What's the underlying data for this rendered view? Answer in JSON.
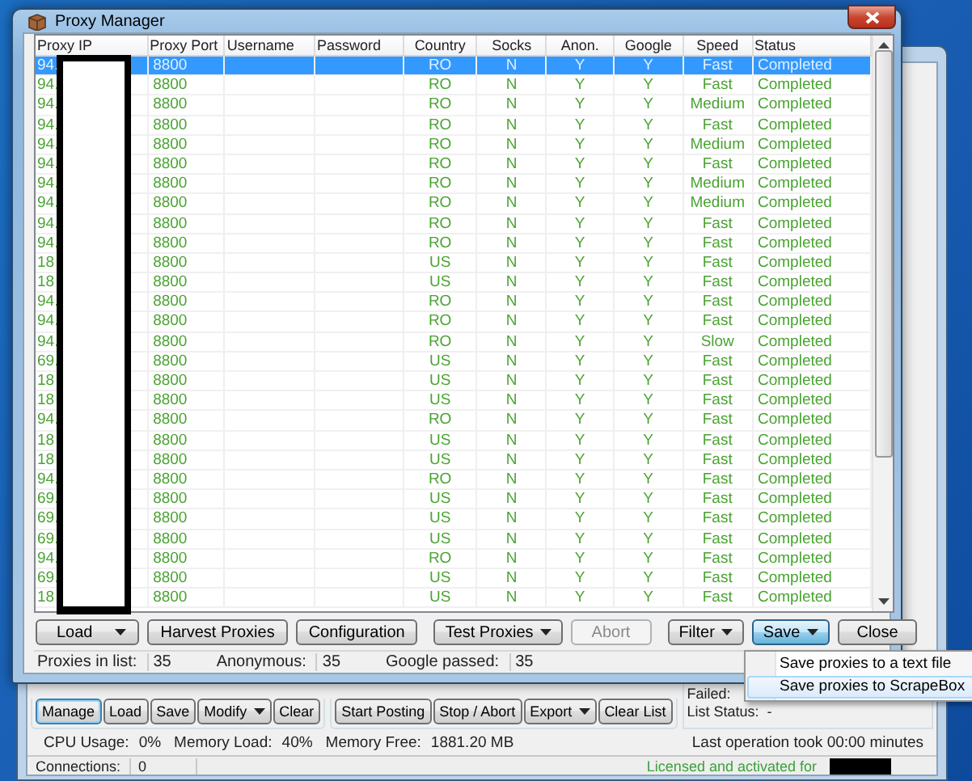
{
  "main_window": {
    "manage_buttons": [
      {
        "label": "Manage",
        "dropdown": false,
        "focused": true
      },
      {
        "label": "Load",
        "dropdown": false,
        "focused": false
      },
      {
        "label": "Save",
        "dropdown": false,
        "focused": false
      },
      {
        "label": "Modify",
        "dropdown": true,
        "focused": false
      },
      {
        "label": "Clear",
        "dropdown": false,
        "focused": false
      }
    ],
    "posting_buttons": [
      {
        "label": "Start Posting",
        "dropdown": false,
        "focused": false
      },
      {
        "label": "Stop / Abort",
        "dropdown": false,
        "focused": false
      },
      {
        "label": "Export",
        "dropdown": true,
        "focused": false
      },
      {
        "label": "Clear List",
        "dropdown": false,
        "focused": false
      }
    ],
    "failed_label": "Failed:",
    "list_status": "List Status:  -",
    "system": [
      {
        "label": "CPU Usage:",
        "value": "0%"
      },
      {
        "label": "Memory Load:",
        "value": "40%"
      },
      {
        "label": "Memory Free:",
        "value": "1881.20 MB"
      }
    ],
    "last_operation": "Last operation took 00:00 minutes",
    "status_bar": {
      "connections_label": "Connections:",
      "connections": "0",
      "license": "Licensed and activated for"
    }
  },
  "proxy_manager": {
    "title": "Proxy Manager",
    "table": {
      "columns": [
        "Proxy IP",
        "Proxy Port",
        "Username",
        "Password",
        "Country",
        "Socks",
        "Anon.",
        "Google",
        "Speed",
        "Status"
      ],
      "rows": [
        {
          "proxy_ip": "94.",
          "proxy_port": "8800",
          "country": "RO",
          "socks": "N",
          "anon": "Y",
          "google": "Y",
          "speed": "Fast",
          "status": "Completed",
          "selected": true
        },
        {
          "proxy_ip": "94.",
          "proxy_port": "8800",
          "country": "RO",
          "socks": "N",
          "anon": "Y",
          "google": "Y",
          "speed": "Fast",
          "status": "Completed",
          "selected": false
        },
        {
          "proxy_ip": "94.",
          "proxy_port": "8800",
          "country": "RO",
          "socks": "N",
          "anon": "Y",
          "google": "Y",
          "speed": "Medium",
          "status": "Completed",
          "selected": false
        },
        {
          "proxy_ip": "94.",
          "proxy_port": "8800",
          "country": "RO",
          "socks": "N",
          "anon": "Y",
          "google": "Y",
          "speed": "Fast",
          "status": "Completed",
          "selected": false
        },
        {
          "proxy_ip": "94.",
          "proxy_port": "8800",
          "country": "RO",
          "socks": "N",
          "anon": "Y",
          "google": "Y",
          "speed": "Medium",
          "status": "Completed",
          "selected": false
        },
        {
          "proxy_ip": "94.",
          "proxy_port": "8800",
          "country": "RO",
          "socks": "N",
          "anon": "Y",
          "google": "Y",
          "speed": "Fast",
          "status": "Completed",
          "selected": false
        },
        {
          "proxy_ip": "94.",
          "proxy_port": "8800",
          "country": "RO",
          "socks": "N",
          "anon": "Y",
          "google": "Y",
          "speed": "Medium",
          "status": "Completed",
          "selected": false
        },
        {
          "proxy_ip": "94.",
          "proxy_port": "8800",
          "country": "RO",
          "socks": "N",
          "anon": "Y",
          "google": "Y",
          "speed": "Medium",
          "status": "Completed",
          "selected": false
        },
        {
          "proxy_ip": "94.",
          "proxy_port": "8800",
          "country": "RO",
          "socks": "N",
          "anon": "Y",
          "google": "Y",
          "speed": "Fast",
          "status": "Completed",
          "selected": false
        },
        {
          "proxy_ip": "94.",
          "proxy_port": "8800",
          "country": "RO",
          "socks": "N",
          "anon": "Y",
          "google": "Y",
          "speed": "Fast",
          "status": "Completed",
          "selected": false
        },
        {
          "proxy_ip": "18",
          "proxy_port": "8800",
          "country": "US",
          "socks": "N",
          "anon": "Y",
          "google": "Y",
          "speed": "Fast",
          "status": "Completed",
          "selected": false
        },
        {
          "proxy_ip": "18",
          "proxy_port": "8800",
          "country": "US",
          "socks": "N",
          "anon": "Y",
          "google": "Y",
          "speed": "Fast",
          "status": "Completed",
          "selected": false
        },
        {
          "proxy_ip": "94.",
          "proxy_port": "8800",
          "country": "RO",
          "socks": "N",
          "anon": "Y",
          "google": "Y",
          "speed": "Fast",
          "status": "Completed",
          "selected": false
        },
        {
          "proxy_ip": "94.",
          "proxy_port": "8800",
          "country": "RO",
          "socks": "N",
          "anon": "Y",
          "google": "Y",
          "speed": "Fast",
          "status": "Completed",
          "selected": false
        },
        {
          "proxy_ip": "94.",
          "proxy_port": "8800",
          "country": "RO",
          "socks": "N",
          "anon": "Y",
          "google": "Y",
          "speed": "Slow",
          "status": "Completed",
          "selected": false
        },
        {
          "proxy_ip": "69.",
          "proxy_port": "8800",
          "country": "US",
          "socks": "N",
          "anon": "Y",
          "google": "Y",
          "speed": "Fast",
          "status": "Completed",
          "selected": false
        },
        {
          "proxy_ip": "18",
          "proxy_port": "8800",
          "country": "US",
          "socks": "N",
          "anon": "Y",
          "google": "Y",
          "speed": "Fast",
          "status": "Completed",
          "selected": false
        },
        {
          "proxy_ip": "18",
          "proxy_port": "8800",
          "country": "US",
          "socks": "N",
          "anon": "Y",
          "google": "Y",
          "speed": "Fast",
          "status": "Completed",
          "selected": false
        },
        {
          "proxy_ip": "94.",
          "proxy_port": "8800",
          "country": "RO",
          "socks": "N",
          "anon": "Y",
          "google": "Y",
          "speed": "Fast",
          "status": "Completed",
          "selected": false
        },
        {
          "proxy_ip": "18",
          "proxy_port": "8800",
          "country": "US",
          "socks": "N",
          "anon": "Y",
          "google": "Y",
          "speed": "Fast",
          "status": "Completed",
          "selected": false
        },
        {
          "proxy_ip": "18",
          "proxy_port": "8800",
          "country": "US",
          "socks": "N",
          "anon": "Y",
          "google": "Y",
          "speed": "Fast",
          "status": "Completed",
          "selected": false
        },
        {
          "proxy_ip": "94.",
          "proxy_port": "8800",
          "country": "RO",
          "socks": "N",
          "anon": "Y",
          "google": "Y",
          "speed": "Fast",
          "status": "Completed",
          "selected": false
        },
        {
          "proxy_ip": "69.",
          "proxy_port": "8800",
          "country": "US",
          "socks": "N",
          "anon": "Y",
          "google": "Y",
          "speed": "Fast",
          "status": "Completed",
          "selected": false
        },
        {
          "proxy_ip": "69.",
          "proxy_port": "8800",
          "country": "US",
          "socks": "N",
          "anon": "Y",
          "google": "Y",
          "speed": "Fast",
          "status": "Completed",
          "selected": false
        },
        {
          "proxy_ip": "69.",
          "proxy_port": "8800",
          "country": "US",
          "socks": "N",
          "anon": "Y",
          "google": "Y",
          "speed": "Fast",
          "status": "Completed",
          "selected": false
        },
        {
          "proxy_ip": "94.",
          "proxy_port": "8800",
          "country": "RO",
          "socks": "N",
          "anon": "Y",
          "google": "Y",
          "speed": "Fast",
          "status": "Completed",
          "selected": false
        },
        {
          "proxy_ip": "69.",
          "proxy_port": "8800",
          "country": "US",
          "socks": "N",
          "anon": "Y",
          "google": "Y",
          "speed": "Fast",
          "status": "Completed",
          "selected": false
        },
        {
          "proxy_ip": "18",
          "proxy_port": "8800",
          "country": "US",
          "socks": "N",
          "anon": "Y",
          "google": "Y",
          "speed": "Fast",
          "status": "Completed",
          "selected": false
        }
      ]
    },
    "file_buttons": [
      {
        "label": "Load",
        "dropdown": true,
        "disabled": false,
        "pressed": false
      },
      {
        "label": "Harvest Proxies",
        "dropdown": false,
        "disabled": false,
        "pressed": false
      },
      {
        "label": "Configuration",
        "dropdown": false,
        "disabled": false,
        "pressed": false
      }
    ],
    "test_buttons": [
      {
        "label": "Test Proxies",
        "dropdown": true,
        "disabled": false,
        "pressed": false
      },
      {
        "label": "Abort",
        "dropdown": false,
        "disabled": true,
        "pressed": false
      }
    ],
    "output_buttons": [
      {
        "label": "Filter",
        "dropdown": true,
        "disabled": false,
        "pressed": false
      },
      {
        "label": "Save",
        "dropdown": true,
        "disabled": false,
        "pressed": true
      },
      {
        "label": "Close",
        "dropdown": false,
        "disabled": false,
        "pressed": false
      }
    ],
    "stats": [
      {
        "label": "Proxies in list:",
        "value": "35"
      },
      {
        "label": "Anonymous:",
        "value": "35"
      },
      {
        "label": "Google passed:",
        "value": "35"
      }
    ],
    "save_menu": {
      "items": [
        {
          "label": "Save proxies to a text file",
          "highlighted": false
        },
        {
          "label": "Save proxies to ScrapeBox",
          "highlighted": true
        }
      ]
    }
  }
}
